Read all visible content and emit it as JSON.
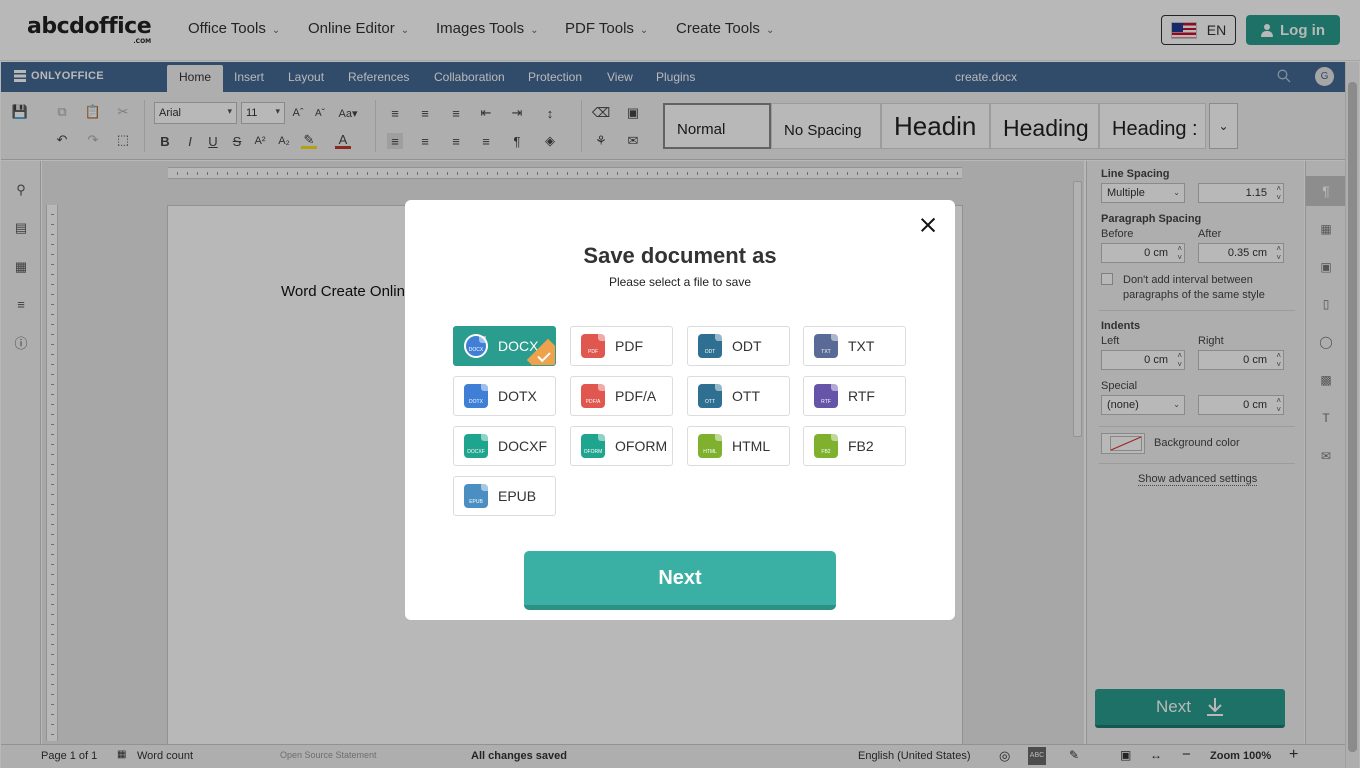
{
  "site": {
    "logo": "abcdoffice",
    "logo_sub": ".COM",
    "nav": [
      "Office Tools",
      "Online Editor",
      "Images Tools",
      "PDF Tools",
      "Create Tools"
    ],
    "language": "EN",
    "login": "Log in"
  },
  "editor": {
    "brand": "ONLYOFFICE",
    "tabs": [
      "Home",
      "Insert",
      "Layout",
      "References",
      "Collaboration",
      "Protection",
      "View",
      "Plugins"
    ],
    "active_tab": "Home",
    "doc_title": "create.docx",
    "avatar": "G",
    "font_name": "Arial",
    "font_size": "11",
    "styles": [
      "Normal",
      "No Spacing",
      "Headin",
      "Heading",
      "Heading :"
    ],
    "page_text": "Word Create Online"
  },
  "right_panel": {
    "line_spacing_label": "Line Spacing",
    "line_spacing_mode": "Multiple",
    "line_spacing_value": "1.15",
    "paragraph_spacing_label": "Paragraph Spacing",
    "before_label": "Before",
    "after_label": "After",
    "before_value": "0 cm",
    "after_value": "0.35 cm",
    "dont_add_interval": "Don't add interval between paragraphs of the same style",
    "indents_label": "Indents",
    "left_label": "Left",
    "right_label": "Right",
    "left_value": "0 cm",
    "right_value": "0 cm",
    "special_label": "Special",
    "special_value": "(none)",
    "special_amount": "0 cm",
    "background_color": "Background color",
    "advanced": "Show advanced settings",
    "next": "Next"
  },
  "status": {
    "page": "Page 1 of 1",
    "word_count": "Word count",
    "open_source": "Open Source Statement",
    "changes": "All changes saved",
    "language": "English (United States)",
    "zoom": "Zoom 100%"
  },
  "modal": {
    "title": "Save document as",
    "subtitle": "Please select a file to save",
    "formats": [
      {
        "label": "DOCX",
        "tag": "DOCX",
        "color": "#3f7fd6"
      },
      {
        "label": "PDF",
        "tag": "PDF",
        "color": "#e0574f"
      },
      {
        "label": "ODT",
        "tag": "ODT",
        "color": "#2f6f92"
      },
      {
        "label": "TXT",
        "tag": "TXT",
        "color": "#5a6a96"
      },
      {
        "label": "DOTX",
        "tag": "DOTX",
        "color": "#3f7fd6"
      },
      {
        "label": "PDF/A",
        "tag": "PDF/A",
        "color": "#e0574f"
      },
      {
        "label": "OTT",
        "tag": "OTT",
        "color": "#2f6f92"
      },
      {
        "label": "RTF",
        "tag": "RTF",
        "color": "#6554a8"
      },
      {
        "label": "DOCXF",
        "tag": "DOCXF",
        "color": "#1fa58e"
      },
      {
        "label": "OFORM",
        "tag": "OFORM",
        "color": "#1fa58e"
      },
      {
        "label": "HTML",
        "tag": "HTML",
        "color": "#7fb12e"
      },
      {
        "label": "FB2",
        "tag": "FB2",
        "color": "#7fb12e"
      },
      {
        "label": "EPUB",
        "tag": "EPUB",
        "color": "#4b8fc2"
      }
    ],
    "selected": "DOCX",
    "next": "Next"
  }
}
